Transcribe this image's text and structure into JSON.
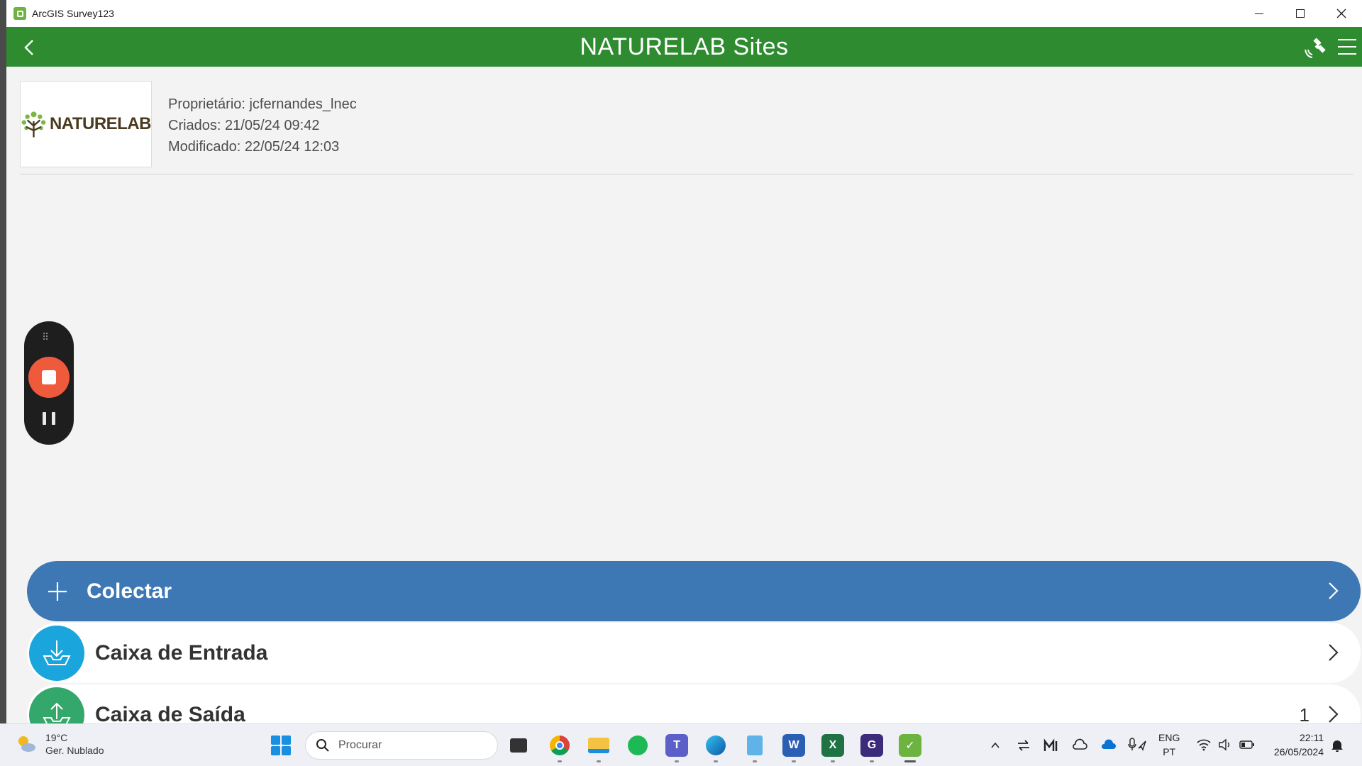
{
  "window": {
    "title": "ArcGIS Survey123"
  },
  "appbar": {
    "title": "NATURELAB Sites"
  },
  "survey": {
    "logo_text": "NATURELAB",
    "owner": "Proprietário: jcfernandes_lnec",
    "created": "Criados: 21/05/24 09:42",
    "modified": "Modificado: 22/05/24 12:03"
  },
  "actions": {
    "collect": {
      "label": "Colectar"
    },
    "inbox": {
      "label": "Caixa de Entrada"
    },
    "outbox": {
      "label": "Caixa de Saída",
      "count": "1"
    }
  },
  "taskbar": {
    "weather_temp": "19°C",
    "weather_desc": "Ger. Nublado",
    "search_placeholder": "Procurar",
    "lang_1": "ENG",
    "lang_2": "PT",
    "time": "22:11",
    "date": "26/05/2024"
  },
  "colors": {
    "appbar": "#2e8b2f",
    "collect": "#3d78b5",
    "inbox": "#1aa5dd",
    "outbox": "#33a86a",
    "record": "#f05a3c"
  }
}
